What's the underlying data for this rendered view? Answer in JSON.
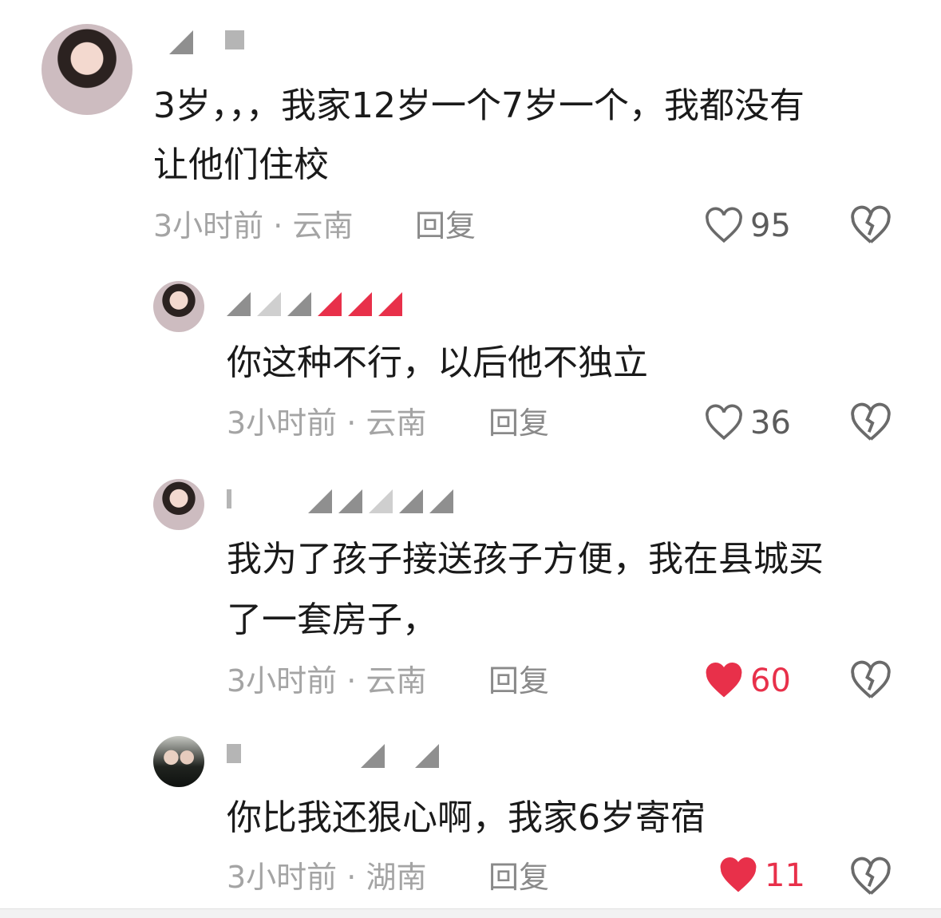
{
  "comments": [
    {
      "text_lines": [
        "3岁，，，我家12岁一个7岁一个，我都没有",
        "让他们住校"
      ],
      "time": "3小时前",
      "location": "云南",
      "reply_label": "回复",
      "likes": "95",
      "liked": false
    },
    {
      "text_lines": [
        "你这种不行，以后他不独立"
      ],
      "time": "3小时前",
      "location": "云南",
      "reply_label": "回复",
      "likes": "36",
      "liked": false
    },
    {
      "text_lines": [
        "我为了孩子接送孩子方便，我在县城买",
        "了一套房子，"
      ],
      "time": "3小时前",
      "location": "云南",
      "reply_label": "回复",
      "likes": "60",
      "liked": true
    },
    {
      "text_lines": [
        "你比我还狠心啊，我家6岁寄宿"
      ],
      "time": "3小时前",
      "location": "湖南",
      "reply_label": "回复",
      "likes": "11",
      "liked": true
    }
  ],
  "meta_separator": "·",
  "colors": {
    "like_active": "#e8304a",
    "meta_gray": "#a4a4a4",
    "text": "#1a1a1a"
  },
  "icons": {
    "like": "heart-icon",
    "dislike": "broken-heart-icon"
  }
}
